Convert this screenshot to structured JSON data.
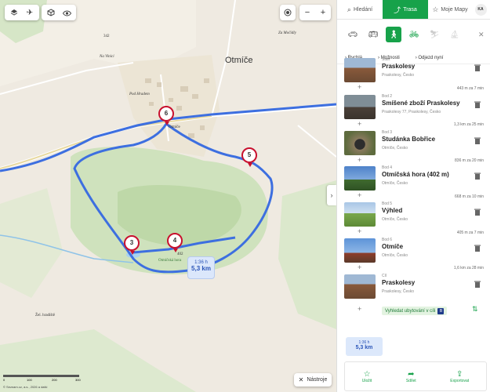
{
  "map": {
    "place_big": "Otmíče",
    "place_small_1": "Za Močidly",
    "place_small_2": "Na Vinici",
    "place_small_3": "Pod Hradem",
    "elev_342": "342",
    "elev_402": "402",
    "hill_label": "Otmíčská hora",
    "village_label": "Otmíče",
    "station_label": "Žel. hradiště",
    "route_time": "1:36 h",
    "route_dist": "5,3 km",
    "markers": [
      "3",
      "4",
      "5",
      "6"
    ],
    "scale_ticks": [
      "0",
      "100",
      "200",
      "300"
    ],
    "scale_unit": "m",
    "copyright": "© Seznam.cz, a.s., 2026 a další",
    "tools_label": "Nástroje",
    "zoom_in": "+",
    "zoom_out": "−"
  },
  "panel": {
    "tabs": [
      {
        "label": "Hledání"
      },
      {
        "label": "Trasa"
      },
      {
        "label": "Moje Mapy"
      }
    ],
    "avatar_initials": "KA",
    "options": [
      "Rychlá",
      "Možnosti",
      "Odjezd nyní"
    ],
    "stops": [
      {
        "kind": "Start",
        "name": "Praskolesy",
        "sub": "Praskolesy, Česko"
      },
      {
        "kind": "Bod 2",
        "name": "Smíšené zboží Praskolesy",
        "sub": "Praskolesy 77, Praskolesy, Česko"
      },
      {
        "kind": "Bod 3",
        "name": "Studánka Bobřice",
        "sub": "Otmíče, Česko"
      },
      {
        "kind": "Bod 4",
        "name": "Otmíčská hora (402 m)",
        "sub": "Otmíče, Česko"
      },
      {
        "kind": "Bod 5",
        "name": "Výhled",
        "sub": "Otmíče, Česko"
      },
      {
        "kind": "Bod 6",
        "name": "Otmíče",
        "sub": "Otmíče, Česko"
      },
      {
        "kind": "Cíl",
        "name": "Praskolesy",
        "sub": "Praskolesy, Česko"
      }
    ],
    "segments": [
      "443 m za 7 min",
      "1,3 km za 25 min",
      "836 m za 20 min",
      "668 m za 10 min",
      "405 m za 7 min",
      "1,6 km za 28 min"
    ],
    "accommodation": "Vyhledat ubytování v cíli",
    "summary_time": "1:36 h",
    "summary_dist": "5,3 km",
    "actions": [
      "Uložit",
      "Sdílet",
      "Exportovat"
    ]
  }
}
